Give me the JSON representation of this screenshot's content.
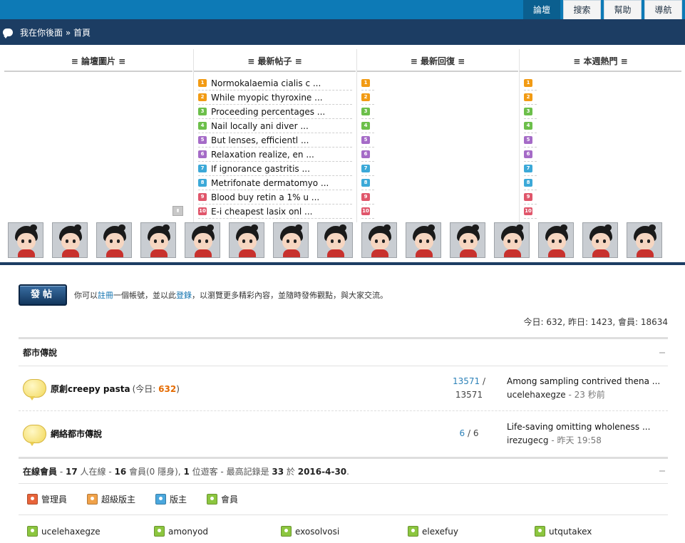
{
  "topnav": [
    "論壇",
    "搜索",
    "幫助",
    "導航"
  ],
  "breadcrumb": "我在你後面 » 首頁",
  "columns": [
    "≡ 論壇圖片 ≡",
    "≡ 最新帖子 ≡",
    "≡ 最新回復 ≡",
    "≡ 本週熱門 ≡"
  ],
  "rank_colors": [
    "#f29b14",
    "#f29b14",
    "#6cbf4a",
    "#6cbf4a",
    "#a56bc7",
    "#a56bc7",
    "#3ca9d8",
    "#3ca9d8",
    "#e0566b",
    "#e0566b"
  ],
  "latest_posts": [
    "Normokalaemia cialis c ...",
    "While myopic thyroxine ...",
    "Proceeding percentages ...",
    "Nail locally ani diver ...",
    "But lenses, efficientl ...",
    "Relaxation realize, en ...",
    "If ignorance gastritis ...",
    "Metrifonate dermatomyo ...",
    "Blood buy retin a 1% u ...",
    "E-i cheapest lasix onl ..."
  ],
  "ranks": [
    "1",
    "2",
    "3",
    "4",
    "5",
    "6",
    "7",
    "8",
    "9",
    "10"
  ],
  "post_button": "發帖",
  "hint": {
    "prefix": "你可以",
    "register": "註冊",
    "mid": "一個帳號，並以此",
    "login": "登錄",
    "suffix": "，以瀏覽更多精彩內容，並隨時發佈觀點，與大家交流。"
  },
  "stats": "今日: 632, 昨日: 1423, 會員: 18634",
  "category": "都市傳說",
  "forums": [
    {
      "name": "原創creepy pasta",
      "today_label_open": "(今日: ",
      "today": "632",
      "today_label_close": ")",
      "threads": "13571",
      "sep": " /",
      "posts": "13571",
      "last_title": "Among sampling contrived thena ...",
      "last_user": "ucelehaxegze",
      "last_time": " - 23 秒前"
    },
    {
      "name": "網絡都市傳說",
      "threads": "6",
      "sep": " / ",
      "posts": "6",
      "last_title": "Life-saving omitting wholeness ...",
      "last_user": "irezugecg",
      "last_time": " - 昨天 19:58"
    }
  ],
  "online": {
    "title": "在線會員",
    "t1": " - ",
    "online_count": "17",
    "t2": " 人在線 - ",
    "member_count": "16",
    "t3": " 會員(0 隱身), ",
    "guest_count": "1",
    "t4": " 位遊客 - 最高記錄是 ",
    "record": "33",
    "t5": " 於 ",
    "record_date": "2016-4-30",
    "t6": "."
  },
  "roles": [
    {
      "label": "管理員",
      "color": "#e8643a"
    },
    {
      "label": "超級版主",
      "color": "#f0a24a"
    },
    {
      "label": "版主",
      "color": "#4aa7dd"
    },
    {
      "label": "會員",
      "color": "#8cc63f"
    }
  ],
  "online_users": [
    "ucelehaxegze",
    "amonyod",
    "exosolvosi",
    "elexefuy",
    "utqutakex"
  ],
  "member_color": "#8cc63f"
}
